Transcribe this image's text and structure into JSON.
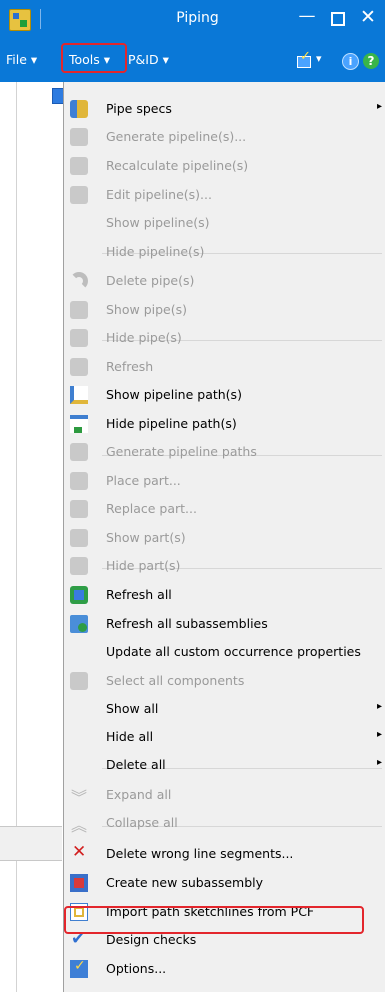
{
  "window": {
    "title": "Piping",
    "min_glyph": "—",
    "close_glyph": "✕"
  },
  "menubar": {
    "file": "File ▾",
    "tools": "Tools ▾",
    "pid": "P&ID ▾",
    "dropdown_arrow": "▾",
    "info_glyph": "i",
    "help_glyph": "?"
  },
  "submenu_arrow": "▸",
  "tools_menu": [
    {
      "label": "Pipe specs",
      "enabled": true,
      "submenu": true,
      "icon": "pipe-specs-icon"
    },
    {
      "label": "Generate pipeline(s)...",
      "enabled": false,
      "icon": "generate-pipeline-icon"
    },
    {
      "label": "Recalculate pipeline(s)",
      "enabled": false,
      "icon": "recalculate-pipeline-icon"
    },
    {
      "label": "Edit pipeline(s)...",
      "enabled": false,
      "icon": "edit-pipeline-icon"
    },
    {
      "label": "Show pipeline(s)",
      "enabled": false,
      "icon": ""
    },
    {
      "label": "Hide pipeline(s)",
      "enabled": false,
      "icon": ""
    },
    {
      "label": "Delete pipe(s)",
      "enabled": false,
      "icon": "delete-pipe-icon"
    },
    {
      "label": "Show pipe(s)",
      "enabled": false,
      "icon": "show-pipe-icon"
    },
    {
      "label": "Hide pipe(s)",
      "enabled": false,
      "icon": "hide-pipe-icon"
    },
    {
      "label": "Refresh",
      "enabled": false,
      "icon": "refresh-icon"
    },
    {
      "label": "Show pipeline path(s)",
      "enabled": true,
      "icon": "show-pipeline-path-icon"
    },
    {
      "label": "Hide pipeline path(s)",
      "enabled": true,
      "icon": "hide-pipeline-path-icon"
    },
    {
      "label": "Generate pipeline paths",
      "enabled": false,
      "icon": "generate-pipeline-paths-icon"
    },
    {
      "label": "Place part...",
      "enabled": false,
      "icon": "place-part-icon"
    },
    {
      "label": "Replace part...",
      "enabled": false,
      "icon": "replace-part-icon"
    },
    {
      "label": "Show part(s)",
      "enabled": false,
      "icon": "show-part-icon"
    },
    {
      "label": "Hide part(s)",
      "enabled": false,
      "icon": "hide-part-icon"
    },
    {
      "label": "Refresh all",
      "enabled": true,
      "icon": "refresh-all-icon"
    },
    {
      "label": "Refresh all subassemblies",
      "enabled": true,
      "icon": "refresh-subassemblies-icon"
    },
    {
      "label": "Update all custom occurrence properties",
      "enabled": true,
      "icon": ""
    },
    {
      "label": "Select all components",
      "enabled": false,
      "icon": "select-components-icon"
    },
    {
      "label": "Show all",
      "enabled": true,
      "submenu": true,
      "icon": ""
    },
    {
      "label": "Hide all",
      "enabled": true,
      "submenu": true,
      "icon": ""
    },
    {
      "label": "Delete all",
      "enabled": true,
      "submenu": true,
      "icon": ""
    },
    {
      "label": "Expand all",
      "enabled": false,
      "icon": "expand-all-icon"
    },
    {
      "label": "Collapse all",
      "enabled": false,
      "icon": "collapse-all-icon"
    },
    {
      "label": "Delete wrong line segments...",
      "enabled": true,
      "icon": "delete-red-x-icon"
    },
    {
      "label": "Create new subassembly",
      "enabled": true,
      "icon": "new-subassembly-icon"
    },
    {
      "label": "Import path sketchlines from PCF",
      "enabled": true,
      "icon": "import-pcf-icon"
    },
    {
      "label": "Design checks",
      "enabled": true,
      "icon": "design-checks-icon"
    },
    {
      "label": "Options...",
      "enabled": true,
      "icon": "options-icon"
    }
  ]
}
